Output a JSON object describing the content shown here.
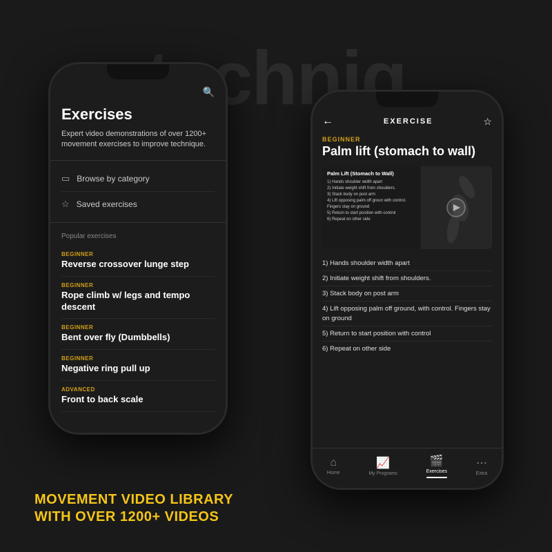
{
  "scene": {
    "background_color": "#1a1a1a",
    "watermark": "techniq"
  },
  "caption": {
    "line1": "MOVEMENT VIDEO LIBRARY",
    "line2": "WITH OVER 1200+ VIDEOS"
  },
  "phone_left": {
    "search_icon": "🔍",
    "title": "Exercises",
    "description": "Expert video demonstrations of over 1200+ movement exercises to improve technique.",
    "menu": [
      {
        "icon": "folder",
        "label": "Browse by category"
      },
      {
        "icon": "star",
        "label": "Saved exercises"
      }
    ],
    "popular_label": "Popular exercises",
    "exercises": [
      {
        "level": "BEGINNER",
        "name": "Reverse crossover lunge step"
      },
      {
        "level": "BEGINNER",
        "name": "Rope climb w/ legs and tempo descent"
      },
      {
        "level": "BEGINNER",
        "name": "Bent over fly (Dumbbells)"
      },
      {
        "level": "BEGINNER",
        "name": "Negative ring pull up"
      },
      {
        "level": "ADVANCED",
        "name": "Front to back scale"
      }
    ]
  },
  "phone_right": {
    "header_title": "EXERCISE",
    "back_label": "←",
    "star_label": "☆",
    "exercise_level": "BEGINNER",
    "exercise_title": "Palm lift (stomach to wall)",
    "video": {
      "title": "Palm Lift (Stomach to Wall)",
      "steps_short": [
        "1) Hands shoulder width apart",
        "2) Initiate weight shift from shoulders.",
        "3) Stack body on post arm",
        "4) Lift opposing palm off groun with control. Fingers stay on ground",
        "5) Return to start position with control",
        "6) Repeat on other side"
      ]
    },
    "instructions": [
      "1) Hands shoulder width apart",
      "2) Initiate weight shift from shoulders.",
      "3) Stack body on post arm",
      "4) Lift opposing palm off ground, with control. Fingers stay on ground",
      "5) Return to start position with control",
      "6) Repeat on other side"
    ],
    "nav": [
      {
        "icon": "⌂",
        "label": "Home",
        "active": false
      },
      {
        "icon": "📊",
        "label": "My Programs",
        "active": false
      },
      {
        "icon": "🎬",
        "label": "Exercises",
        "active": true
      },
      {
        "icon": "⋯",
        "label": "Extra",
        "active": false
      }
    ]
  }
}
